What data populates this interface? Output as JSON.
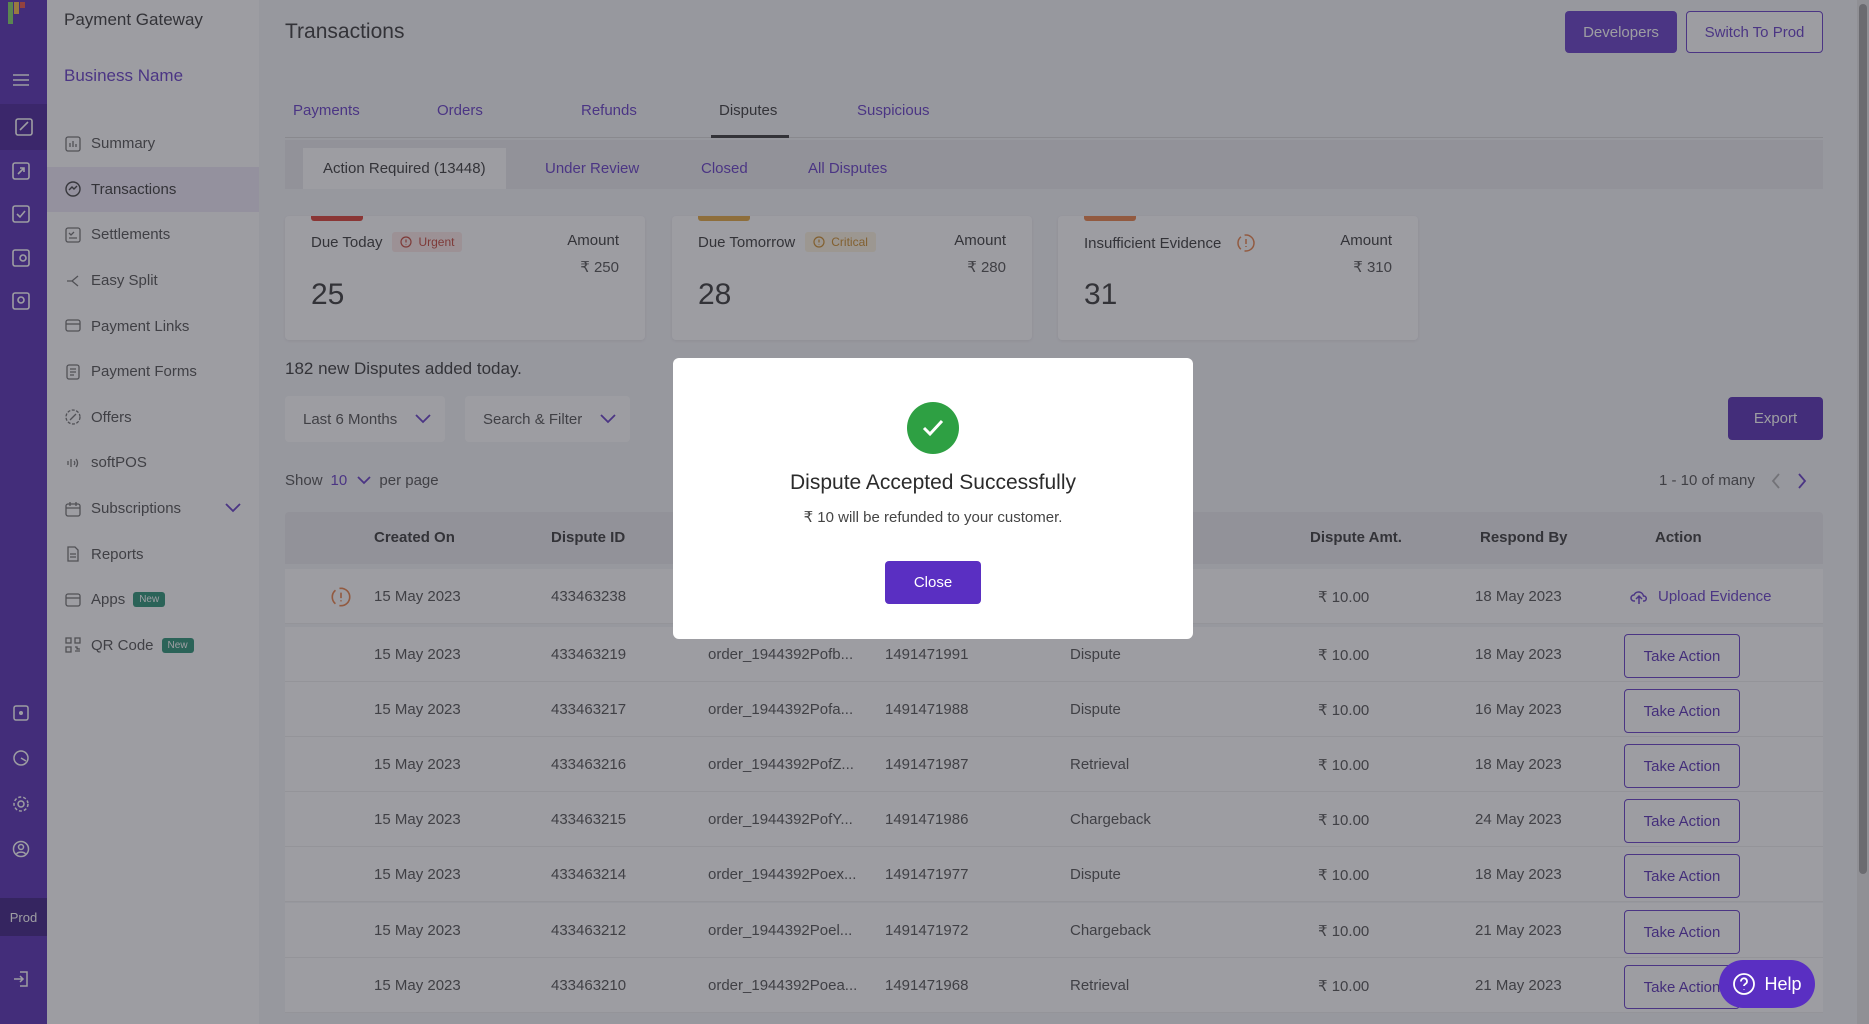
{
  "app": {
    "brand": "Payment Gateway",
    "business_name": "Business Name",
    "env_label": "Prod"
  },
  "sidebar": {
    "items": [
      {
        "label": "Summary",
        "icon": "summary-icon"
      },
      {
        "label": "Transactions",
        "icon": "transactions-icon"
      },
      {
        "label": "Settlements",
        "icon": "settlements-icon"
      },
      {
        "label": "Easy Split",
        "icon": "split-icon"
      },
      {
        "label": "Payment Links",
        "icon": "link-icon"
      },
      {
        "label": "Payment Forms",
        "icon": "form-icon"
      },
      {
        "label": "Offers",
        "icon": "offer-icon"
      },
      {
        "label": "softPOS",
        "icon": "pos-icon"
      },
      {
        "label": "Subscriptions",
        "icon": "subscription-icon"
      },
      {
        "label": "Reports",
        "icon": "report-icon"
      },
      {
        "label": "Apps",
        "icon": "apps-icon",
        "badge": "New"
      },
      {
        "label": "QR Code",
        "icon": "qr-icon",
        "badge": "New"
      }
    ]
  },
  "header": {
    "title": "Transactions",
    "developers_label": "Developers",
    "switch_label": "Switch To Prod"
  },
  "tabs": [
    "Payments",
    "Orders",
    "Refunds",
    "Disputes",
    "Suspicious"
  ],
  "subtabs": [
    "Action Required (13448)",
    "Under Review",
    "Closed",
    "All Disputes"
  ],
  "cards": [
    {
      "label": "Due Today",
      "tag": "Urgent",
      "amount_label": "Amount",
      "amount": "₹ 250",
      "count": "25",
      "color": "#d93025"
    },
    {
      "label": "Due Tomorrow",
      "tag": "Critical",
      "amount_label": "Amount",
      "amount": "₹ 280",
      "count": "28",
      "color": "#e0a030"
    },
    {
      "label": "Insufficient Evidence",
      "amount_label": "Amount",
      "amount": "₹ 310",
      "count": "31",
      "color": "#e8783a"
    }
  ],
  "new_disputes": "182 new Disputes added today.",
  "filters": {
    "period": "Last 6 Months",
    "search": "Search & Filter",
    "export": "Export"
  },
  "pagination": {
    "show": "Show",
    "per_page_value": "10",
    "per_page": "per page",
    "range": "1 - 10 of many"
  },
  "table": {
    "columns": [
      "Created On",
      "Dispute ID",
      "Dispute Amt.",
      "Respond By",
      "Action"
    ],
    "rows": [
      {
        "created": "15 May 2023",
        "id": "433463238",
        "order": "",
        "txn": "",
        "type": "",
        "amt": "₹ 10.00",
        "respond": "18 May 2023",
        "action": "Upload Evidence"
      },
      {
        "created": "15 May 2023",
        "id": "433463219",
        "order": "order_1944392Pofb...",
        "txn": "1491471991",
        "type": "Dispute",
        "amt": "₹ 10.00",
        "respond": "18 May 2023",
        "action": "Take Action"
      },
      {
        "created": "15 May 2023",
        "id": "433463217",
        "order": "order_1944392Pofa...",
        "txn": "1491471988",
        "type": "Dispute",
        "amt": "₹ 10.00",
        "respond": "16 May 2023",
        "action": "Take Action"
      },
      {
        "created": "15 May 2023",
        "id": "433463216",
        "order": "order_1944392PofZ...",
        "txn": "1491471987",
        "type": "Retrieval",
        "amt": "₹ 10.00",
        "respond": "18 May 2023",
        "action": "Take Action"
      },
      {
        "created": "15 May 2023",
        "id": "433463215",
        "order": "order_1944392PofY...",
        "txn": "1491471986",
        "type": "Chargeback",
        "amt": "₹ 10.00",
        "respond": "24 May 2023",
        "action": "Take Action"
      },
      {
        "created": "15 May 2023",
        "id": "433463214",
        "order": "order_1944392Poex...",
        "txn": "1491471977",
        "type": "Dispute",
        "amt": "₹ 10.00",
        "respond": "18 May 2023",
        "action": "Take Action"
      },
      {
        "created": "15 May 2023",
        "id": "433463212",
        "order": "order_1944392Poel...",
        "txn": "1491471972",
        "type": "Chargeback",
        "amt": "₹ 10.00",
        "respond": "21 May 2023",
        "action": "Take Action"
      },
      {
        "created": "15 May 2023",
        "id": "433463210",
        "order": "order_1944392Poea...",
        "txn": "1491471968",
        "type": "Retrieval",
        "amt": "₹ 10.00",
        "respond": "21 May 2023",
        "action": "Take Action"
      }
    ]
  },
  "modal": {
    "title": "Dispute Accepted Successfully",
    "message": "₹ 10 will be refunded to your customer.",
    "close_label": "Close"
  },
  "help_label": "Help"
}
